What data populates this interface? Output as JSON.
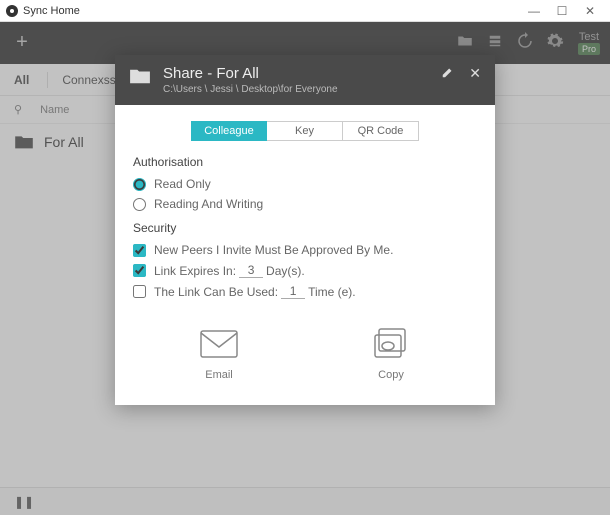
{
  "window": {
    "title": "Sync Home"
  },
  "toolbar": {
    "test_label": "Test",
    "pro_label": "Pro"
  },
  "subbar": {
    "all": "All",
    "search_placeholder": "Connexsse"
  },
  "columns": {
    "name": "Name"
  },
  "folders": [
    {
      "name": "For All"
    }
  ],
  "modal": {
    "title": "Share - For All",
    "path": "C:\\Users \\ Jessi \\ Desktop\\for Everyone",
    "tabs": {
      "colleague": "Colleague",
      "key": "Key",
      "qrcode": "QR Code"
    },
    "sections": {
      "authorisation": "Authorisation",
      "security": "Security"
    },
    "auth": {
      "read_only": "Read Only",
      "read_write": "Reading And Writing"
    },
    "sec": {
      "approve": "New Peers I Invite Must Be Approved By Me.",
      "expires_prefix": "Link Expires In:",
      "expires_value": "3",
      "expires_suffix": "Day(s).",
      "uses_prefix": "The Link Can Be Used:",
      "uses_value": "1",
      "uses_suffix": "Time (e)."
    },
    "actions": {
      "email": "Email",
      "copy": "Copy"
    }
  }
}
